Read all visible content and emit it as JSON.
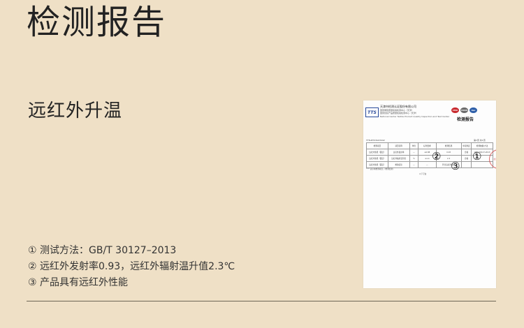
{
  "page": {
    "title": "检测报告",
    "subtitle": "远红外升温",
    "points": [
      "① 测试方法：GB/T 30127–2013",
      "② 远红外发射率0.93，远红外辐射温升值2.3℃",
      "③ 产品具有远红外性能"
    ]
  },
  "report": {
    "logo_text": "TTS",
    "header_lines": [
      "天津市检测认证股份有限公司",
      "国家服装质量检验检测中心（天津）",
      "国家纺织产品质量检验检测中心（天津）",
      "National Center Textile Product Quality Inspection and Test Center"
    ],
    "seals": [
      "CMA",
      "CNAS",
      "ilac"
    ],
    "title": "检测报告",
    "report_no": "TTTs-BT23A03442",
    "page_no": "第1页 共1页",
    "table": {
      "headers": [
        "检测项目",
        "项目名称",
        "单位",
        "标准要求",
        "检测结果",
        "单项判定",
        "检测依据/方法"
      ],
      "rows": [
        [
          "远红外性能（面层）",
          "远红外发射率",
          "—",
          "≥0.88",
          "0.93",
          "合格",
          "GB/T 30127-2013"
        ],
        [
          "远红外性能（面层）",
          "远红外辐射温升值",
          "℃",
          "≥1.4",
          "2.3",
          "合格",
          ""
        ],
        [
          "远红外性能（面层）",
          "检验结论",
          "—",
          "—",
          "符合远红外性能",
          "",
          ""
        ]
      ]
    },
    "note": "\"**\" 表示未检测项目，(检测结果)",
    "blank_below": "以下空白",
    "stamp_text": "检验专用章",
    "markers": [
      "①",
      "②",
      "③"
    ]
  },
  "colors": {
    "background": "#efe0c6",
    "text": "#222222",
    "rule": "#6e6656",
    "tts_blue": "#27489a",
    "stamp_red": "#d23b3b"
  }
}
